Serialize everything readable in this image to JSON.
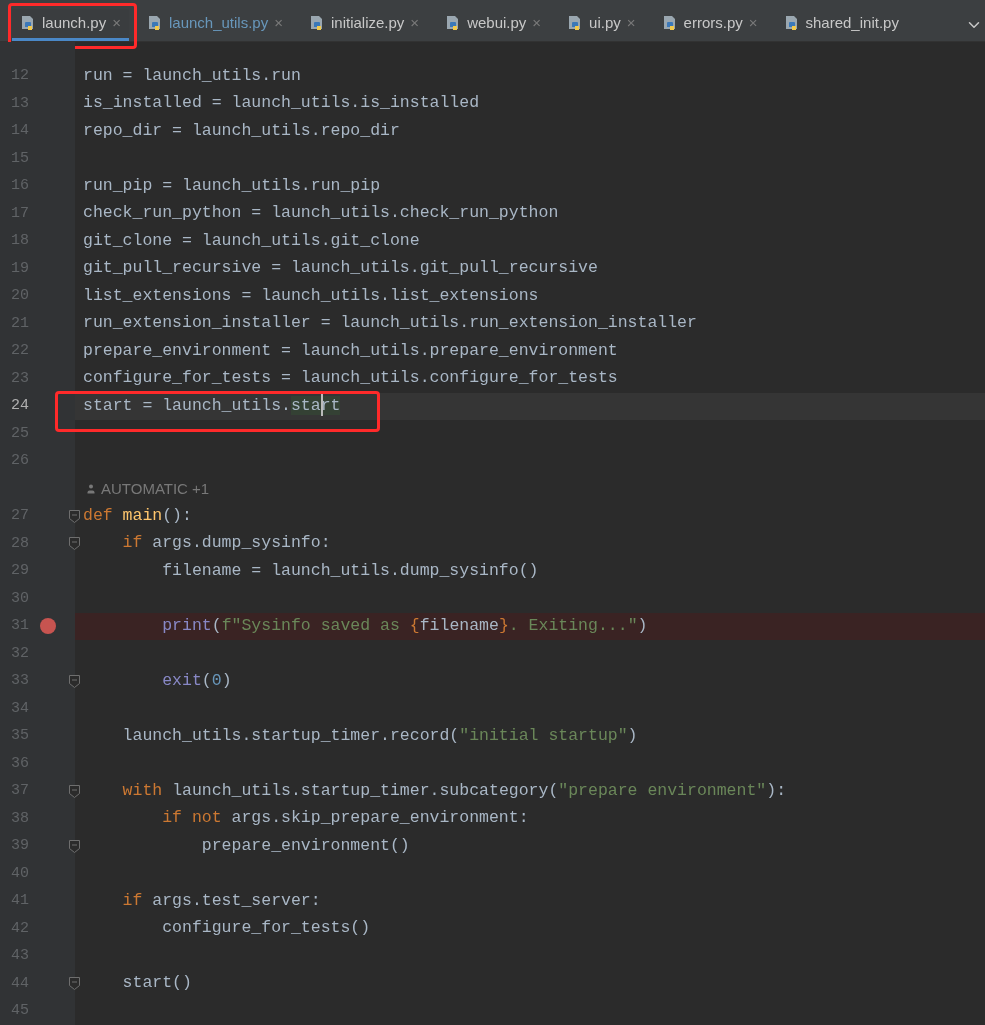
{
  "tabs": [
    {
      "label": "launch.py",
      "selected": true,
      "modified": false,
      "annotated": true,
      "close": "×"
    },
    {
      "label": "launch_utils.py",
      "selected": false,
      "modified": true,
      "annotated": false,
      "close": "×"
    },
    {
      "label": "initialize.py",
      "selected": false,
      "modified": false,
      "annotated": false,
      "close": "×"
    },
    {
      "label": "webui.py",
      "selected": false,
      "modified": false,
      "annotated": false,
      "close": "×"
    },
    {
      "label": "ui.py",
      "selected": false,
      "modified": false,
      "annotated": false,
      "close": "×"
    },
    {
      "label": "errors.py",
      "selected": false,
      "modified": false,
      "annotated": false,
      "close": "×"
    },
    {
      "label": "shared_init.py",
      "selected": false,
      "modified": false,
      "annotated": false
    }
  ],
  "lines": [
    {
      "kind": "code",
      "number": "12",
      "tokens": [
        {
          "t": "run = launch_utils.run",
          "kind": "plain"
        }
      ]
    },
    {
      "kind": "code",
      "number": "13",
      "tokens": [
        {
          "t": "is_installed = launch_utils.is_installed",
          "kind": "plain"
        }
      ]
    },
    {
      "kind": "code",
      "number": "14",
      "tokens": [
        {
          "t": "repo_dir = launch_utils.repo_dir",
          "kind": "plain"
        }
      ]
    },
    {
      "kind": "code",
      "number": "15"
    },
    {
      "kind": "code",
      "number": "16",
      "tokens": [
        {
          "t": "run_pip = launch_utils.run_pip",
          "kind": "plain"
        }
      ]
    },
    {
      "kind": "code",
      "number": "17",
      "tokens": [
        {
          "t": "check_run_python = launch_utils.check_run_python",
          "kind": "plain"
        }
      ]
    },
    {
      "kind": "code",
      "number": "18",
      "tokens": [
        {
          "t": "git_clone = launch_utils.git_clone",
          "kind": "plain"
        }
      ]
    },
    {
      "kind": "code",
      "number": "19",
      "tokens": [
        {
          "t": "git_pull_recursive = launch_utils.git_pull_recursive",
          "kind": "plain"
        }
      ]
    },
    {
      "kind": "code",
      "number": "20",
      "tokens": [
        {
          "t": "list_extensions = launch_utils.list_extensions",
          "kind": "plain"
        }
      ]
    },
    {
      "kind": "code",
      "number": "21",
      "tokens": [
        {
          "t": "run_extension_installer = launch_utils.run_extension_installer",
          "kind": "plain"
        }
      ]
    },
    {
      "kind": "code",
      "number": "22",
      "tokens": [
        {
          "t": "prepare_environment = launch_utils.prepare_environment",
          "kind": "plain"
        }
      ]
    },
    {
      "kind": "code",
      "number": "23",
      "tokens": [
        {
          "t": "configure_for_tests = launch_utils.configure_for_tests",
          "kind": "plain"
        }
      ]
    },
    {
      "kind": "code",
      "number": "24",
      "current": true,
      "annotated": true,
      "tokens": [
        {
          "t": "start = launch_utils.",
          "kind": "plain"
        },
        {
          "t": "sta",
          "kind": "match"
        },
        {
          "t": "rt",
          "kind": "match",
          "caret": true
        }
      ]
    },
    {
      "kind": "code",
      "number": "25"
    },
    {
      "kind": "code",
      "number": "26"
    },
    {
      "kind": "inlay",
      "text": "AUTOMATIC +1"
    },
    {
      "kind": "code",
      "number": "27",
      "fold": true,
      "tokens": [
        {
          "t": "def ",
          "kind": "kw"
        },
        {
          "t": "main",
          "kind": "def"
        },
        {
          "t": "():",
          "kind": "plain"
        }
      ]
    },
    {
      "kind": "code",
      "number": "28",
      "fold": true,
      "tokens": [
        {
          "t": "    if ",
          "kind": "kw"
        },
        {
          "t": "args.dump_sysinfo:",
          "kind": "plain"
        }
      ]
    },
    {
      "kind": "code",
      "number": "29",
      "tokens": [
        {
          "t": "        filename = launch_utils.dump_sysinfo()",
          "kind": "plain"
        }
      ]
    },
    {
      "kind": "code",
      "number": "30"
    },
    {
      "kind": "code",
      "number": "31",
      "breakpoint": true,
      "tokens": [
        {
          "t": "        print",
          "kind": "builtin"
        },
        {
          "t": "(",
          "kind": "plain"
        },
        {
          "t": "f\"Sysinfo saved as ",
          "kind": "str"
        },
        {
          "t": "{",
          "kind": "kw"
        },
        {
          "t": "filename",
          "kind": "plain"
        },
        {
          "t": "}",
          "kind": "kw"
        },
        {
          "t": ". Exiting...\"",
          "kind": "str"
        },
        {
          "t": ")",
          "kind": "plain"
        }
      ]
    },
    {
      "kind": "code",
      "number": "32"
    },
    {
      "kind": "code",
      "number": "33",
      "fold": true,
      "tokens": [
        {
          "t": "        exit",
          "kind": "builtin"
        },
        {
          "t": "(",
          "kind": "plain"
        },
        {
          "t": "0",
          "kind": "num"
        },
        {
          "t": ")",
          "kind": "plain"
        }
      ]
    },
    {
      "kind": "code",
      "number": "34"
    },
    {
      "kind": "code",
      "number": "35",
      "tokens": [
        {
          "t": "    launch_utils.startup_timer.record(",
          "kind": "plain"
        },
        {
          "t": "\"initial startup\"",
          "kind": "str"
        },
        {
          "t": ")",
          "kind": "plain"
        }
      ]
    },
    {
      "kind": "code",
      "number": "36"
    },
    {
      "kind": "code",
      "number": "37",
      "fold": true,
      "tokens": [
        {
          "t": "    with ",
          "kind": "kw"
        },
        {
          "t": "launch_utils.startup_timer.subcategory(",
          "kind": "plain"
        },
        {
          "t": "\"prepare environment\"",
          "kind": "str"
        },
        {
          "t": "):",
          "kind": "plain"
        }
      ]
    },
    {
      "kind": "code",
      "number": "38",
      "tokens": [
        {
          "t": "        if not ",
          "kind": "kw"
        },
        {
          "t": "args.skip_prepare_environment:",
          "kind": "plain"
        }
      ]
    },
    {
      "kind": "code",
      "number": "39",
      "fold": true,
      "tokens": [
        {
          "t": "            prepare_environment()",
          "kind": "plain"
        }
      ]
    },
    {
      "kind": "code",
      "number": "40"
    },
    {
      "kind": "code",
      "number": "41",
      "tokens": [
        {
          "t": "    if ",
          "kind": "kw"
        },
        {
          "t": "args.test_server:",
          "kind": "plain"
        }
      ]
    },
    {
      "kind": "code",
      "number": "42",
      "tokens": [
        {
          "t": "        configure_for_tests()",
          "kind": "plain"
        }
      ]
    },
    {
      "kind": "code",
      "number": "43"
    },
    {
      "kind": "code",
      "number": "44",
      "fold": true,
      "tokens": [
        {
          "t": "    start()",
          "kind": "plain"
        }
      ]
    },
    {
      "kind": "code",
      "number": "45"
    }
  ]
}
